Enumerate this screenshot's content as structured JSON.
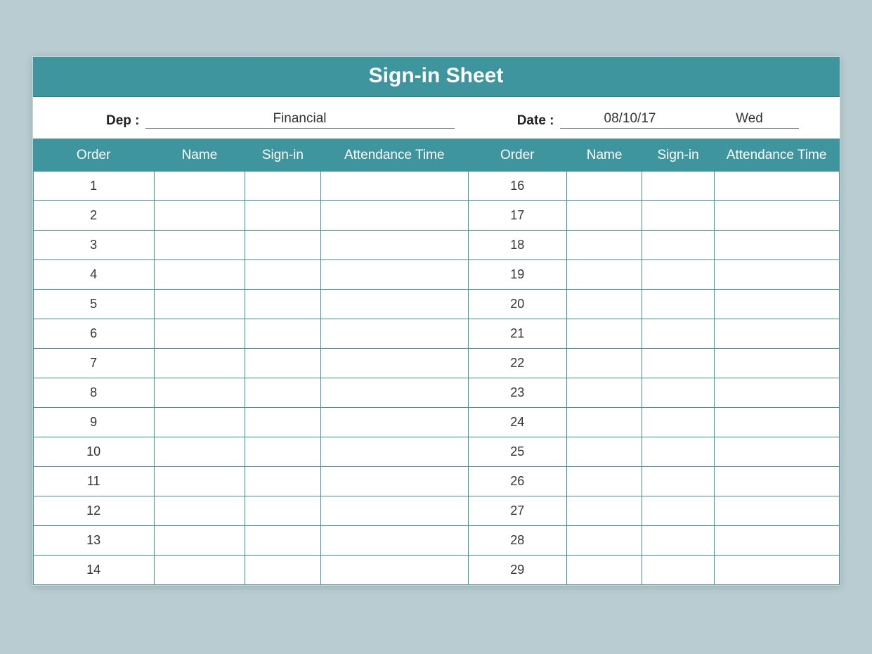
{
  "title": "Sign-in Sheet",
  "meta": {
    "dep_label": "Dep :",
    "dep_value": "Financial",
    "date_label": "Date :",
    "date_value": "08/10/17",
    "day_value": "Wed"
  },
  "headers": {
    "order": "Order",
    "name": "Name",
    "signin": "Sign-in",
    "attendance": "Attendance Time"
  },
  "rows_left": [
    {
      "order": "1",
      "name": "",
      "signin": "",
      "attendance": ""
    },
    {
      "order": "2",
      "name": "",
      "signin": "",
      "attendance": ""
    },
    {
      "order": "3",
      "name": "",
      "signin": "",
      "attendance": ""
    },
    {
      "order": "4",
      "name": "",
      "signin": "",
      "attendance": ""
    },
    {
      "order": "5",
      "name": "",
      "signin": "",
      "attendance": ""
    },
    {
      "order": "6",
      "name": "",
      "signin": "",
      "attendance": ""
    },
    {
      "order": "7",
      "name": "",
      "signin": "",
      "attendance": ""
    },
    {
      "order": "8",
      "name": "",
      "signin": "",
      "attendance": ""
    },
    {
      "order": "9",
      "name": "",
      "signin": "",
      "attendance": ""
    },
    {
      "order": "10",
      "name": "",
      "signin": "",
      "attendance": ""
    },
    {
      "order": "11",
      "name": "",
      "signin": "",
      "attendance": ""
    },
    {
      "order": "12",
      "name": "",
      "signin": "",
      "attendance": ""
    },
    {
      "order": "13",
      "name": "",
      "signin": "",
      "attendance": ""
    },
    {
      "order": "14",
      "name": "",
      "signin": "",
      "attendance": ""
    }
  ],
  "rows_right": [
    {
      "order": "16",
      "name": "",
      "signin": "",
      "attendance": ""
    },
    {
      "order": "17",
      "name": "",
      "signin": "",
      "attendance": ""
    },
    {
      "order": "18",
      "name": "",
      "signin": "",
      "attendance": ""
    },
    {
      "order": "19",
      "name": "",
      "signin": "",
      "attendance": ""
    },
    {
      "order": "20",
      "name": "",
      "signin": "",
      "attendance": ""
    },
    {
      "order": "21",
      "name": "",
      "signin": "",
      "attendance": ""
    },
    {
      "order": "22",
      "name": "",
      "signin": "",
      "attendance": ""
    },
    {
      "order": "23",
      "name": "",
      "signin": "",
      "attendance": ""
    },
    {
      "order": "24",
      "name": "",
      "signin": "",
      "attendance": ""
    },
    {
      "order": "25",
      "name": "",
      "signin": "",
      "attendance": ""
    },
    {
      "order": "26",
      "name": "",
      "signin": "",
      "attendance": ""
    },
    {
      "order": "27",
      "name": "",
      "signin": "",
      "attendance": ""
    },
    {
      "order": "28",
      "name": "",
      "signin": "",
      "attendance": ""
    },
    {
      "order": "29",
      "name": "",
      "signin": "",
      "attendance": ""
    }
  ]
}
